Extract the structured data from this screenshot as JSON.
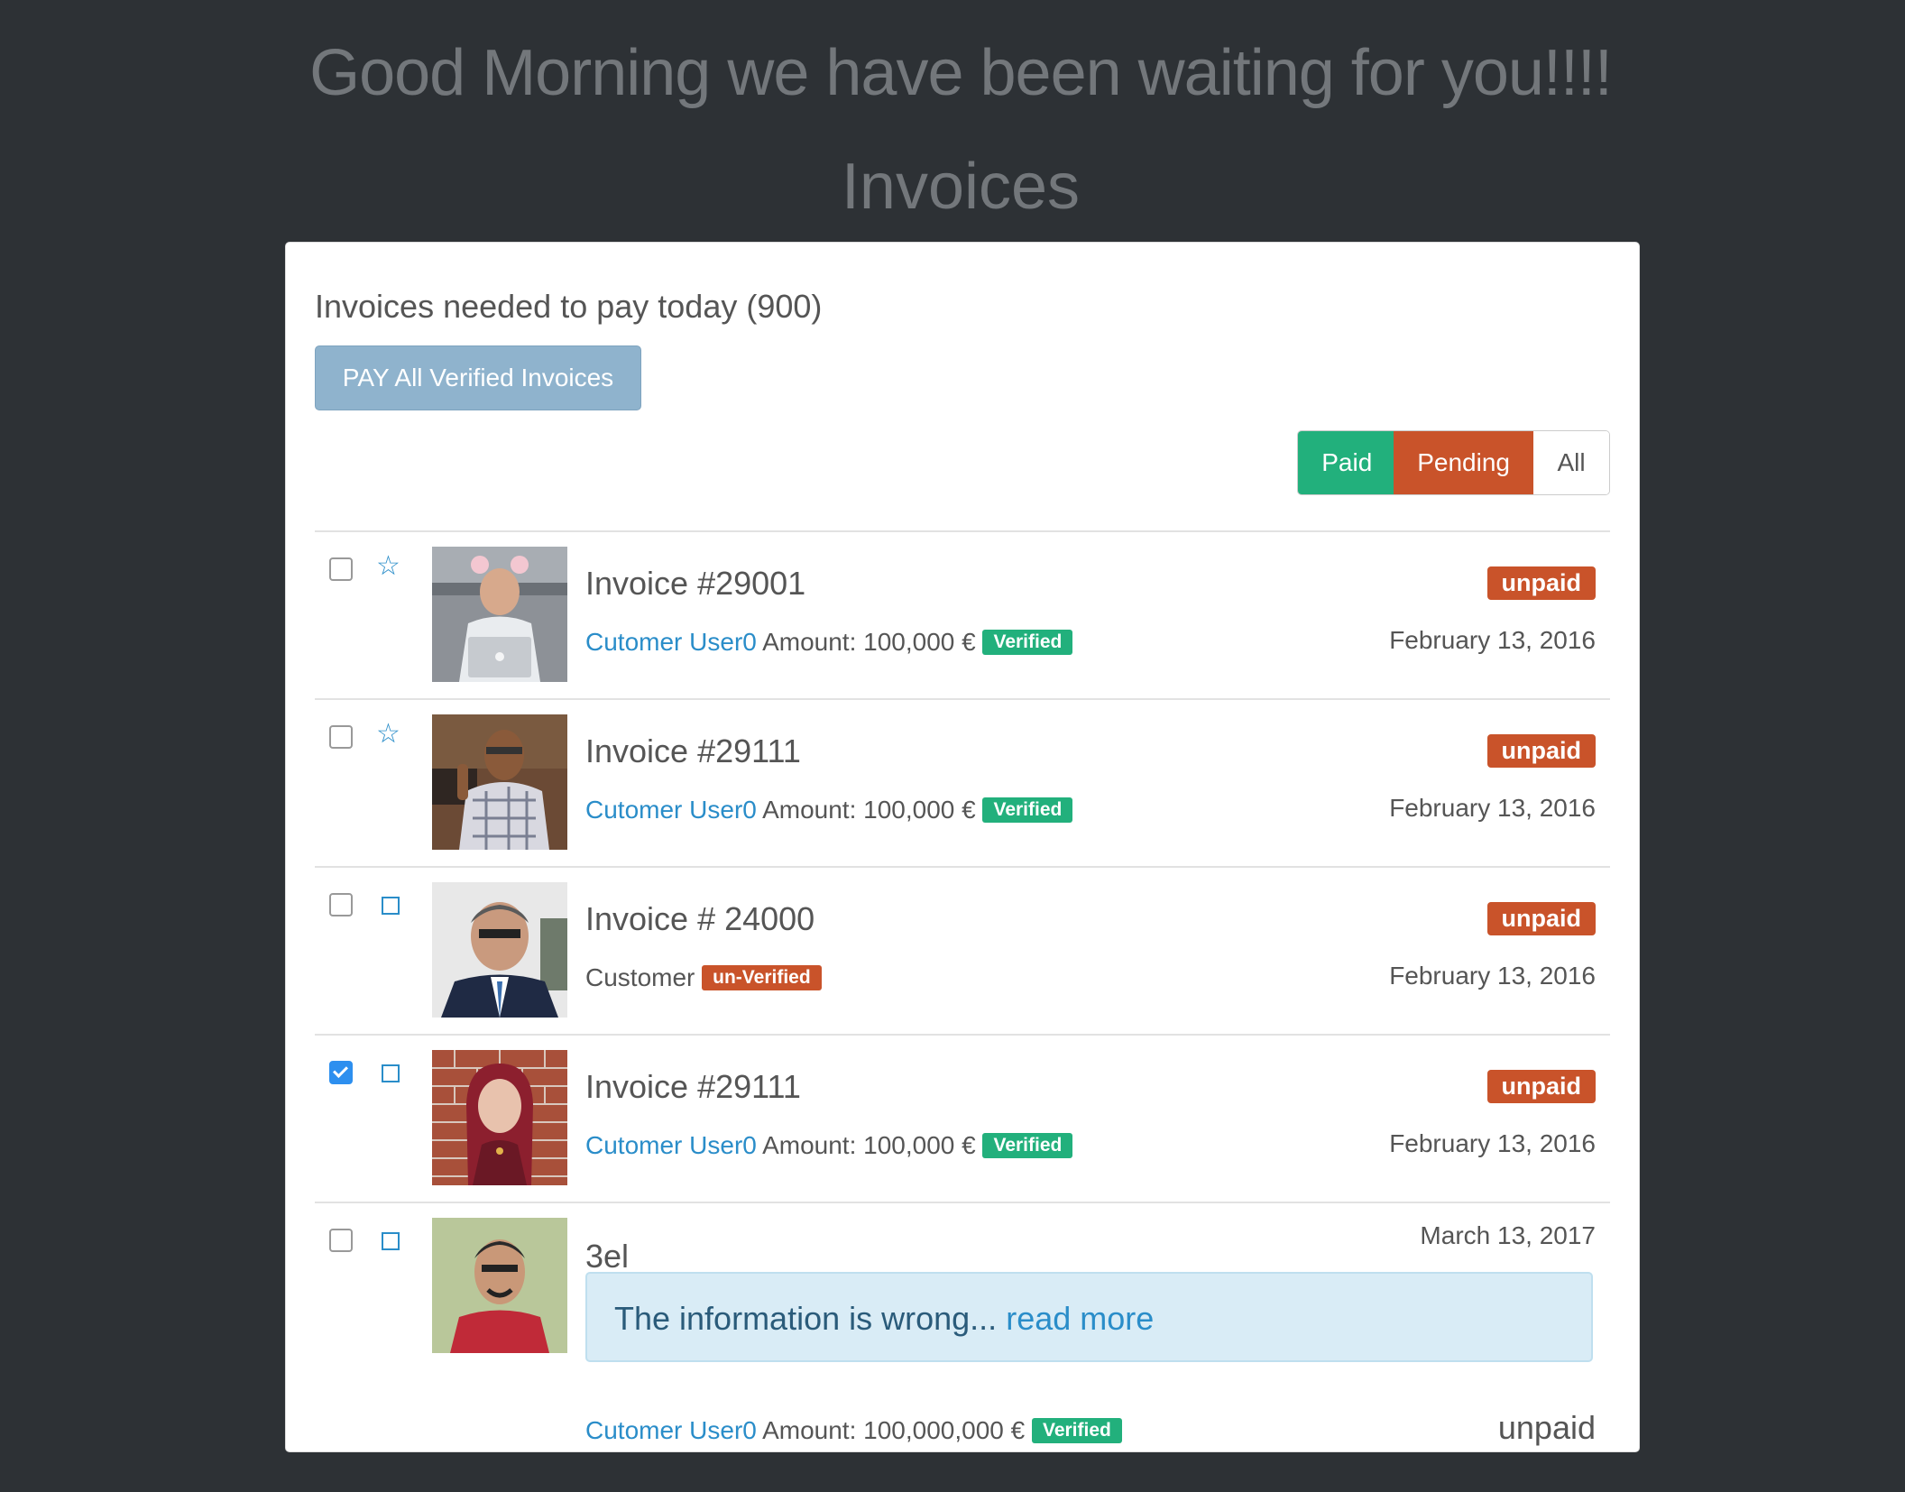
{
  "greeting": "Good Morning we have been waiting for you!!!!",
  "page_title": "Invoices",
  "panel": {
    "heading": "Invoices needed to pay today (900)",
    "pay_button": "PAY All Verified Invoices",
    "filters": {
      "paid": "Paid",
      "pending": "Pending",
      "all": "All"
    }
  },
  "colors": {
    "background": "#2d3135",
    "verified": "#22b07c",
    "unpaid": "#c9532a",
    "link": "#2a8dc9",
    "pay_button": "#8fb3cd"
  },
  "invoices": [
    {
      "checked": false,
      "flag_icon": "star-icon",
      "title": "Invoice #29001",
      "customer_link": "Cutomer User0",
      "amount": "Amount: 100,000 €",
      "verification": "Verified",
      "status": "unpaid",
      "date": "February 13, 2016"
    },
    {
      "checked": false,
      "flag_icon": "star-icon",
      "title": "Invoice #29111",
      "customer_link": "Cutomer User0",
      "amount": "Amount: 100,000 €",
      "verification": "Verified",
      "status": "unpaid",
      "date": "February 13, 2016"
    },
    {
      "checked": false,
      "flag_icon": "square-icon",
      "title": "Invoice # 24000",
      "customer_label": "Customer",
      "verification": "un-Verified",
      "status": "unpaid",
      "date": "February 13, 2016"
    },
    {
      "checked": true,
      "flag_icon": "square-icon",
      "title": "Invoice #29111",
      "customer_link": "Cutomer User0",
      "amount": "Amount: 100,000 €",
      "verification": "Verified",
      "status": "unpaid",
      "date": "February 13, 2016"
    },
    {
      "checked": false,
      "flag_icon": "square-icon",
      "title": "3el",
      "date": "March 13, 2017",
      "message": "The information is wrong...",
      "read_more": "read more",
      "customer_link": "Cutomer User0",
      "amount": "Amount: 100,000,000 €",
      "verification": "Verified",
      "status": "unpaid"
    }
  ]
}
